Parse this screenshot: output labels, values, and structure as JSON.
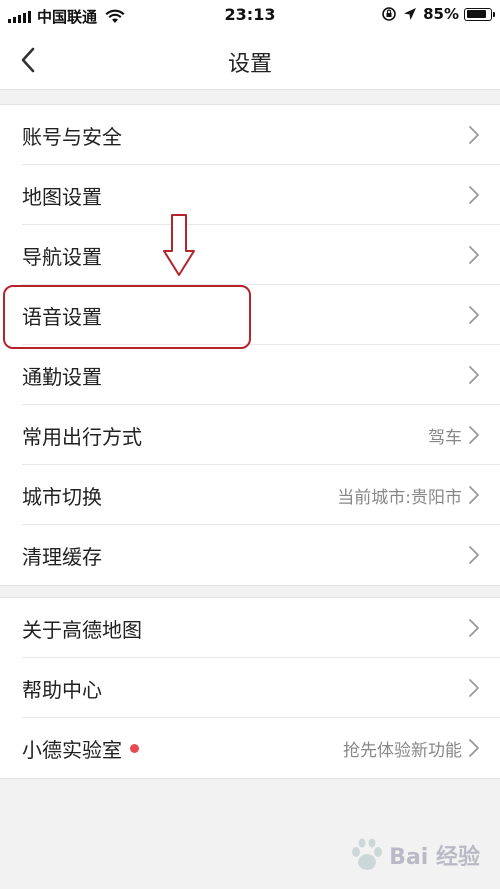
{
  "status_bar": {
    "carrier": "中国联通",
    "time": "23:13",
    "battery": "85%",
    "battery_level": 0.85,
    "icons": [
      "signal-icon",
      "wifi-icon",
      "orientation-lock-icon",
      "location-arrow-icon",
      "battery-icon"
    ]
  },
  "header": {
    "title": "设置",
    "back_icon": "chevron-left-icon"
  },
  "groups": [
    {
      "items": [
        {
          "label": "账号与安全",
          "value": ""
        },
        {
          "label": "地图设置",
          "value": ""
        },
        {
          "label": "导航设置",
          "value": ""
        },
        {
          "label": "语音设置",
          "value": ""
        },
        {
          "label": "通勤设置",
          "value": ""
        },
        {
          "label": "常用出行方式",
          "value": "驾车"
        },
        {
          "label": "城市切换",
          "value": "当前城市:贵阳市"
        },
        {
          "label": "清理缓存",
          "value": ""
        }
      ]
    },
    {
      "items": [
        {
          "label": "关于高德地图",
          "value": ""
        },
        {
          "label": "帮助中心",
          "value": ""
        },
        {
          "label": "小德实验室",
          "value": "抢先体验新功能",
          "badge": "red-dot"
        }
      ]
    }
  ],
  "annotation": {
    "highlighted_item": "语音设置",
    "arrow_icon": "down-arrow-icon",
    "highlight_color": "#b3242c"
  },
  "watermark": {
    "text": "Bai 经验"
  },
  "colors": {
    "background": "#f2f2f2",
    "row_background": "#ffffff",
    "text": "#222222",
    "secondary_text": "#888888",
    "badge": "#e84a4f"
  }
}
